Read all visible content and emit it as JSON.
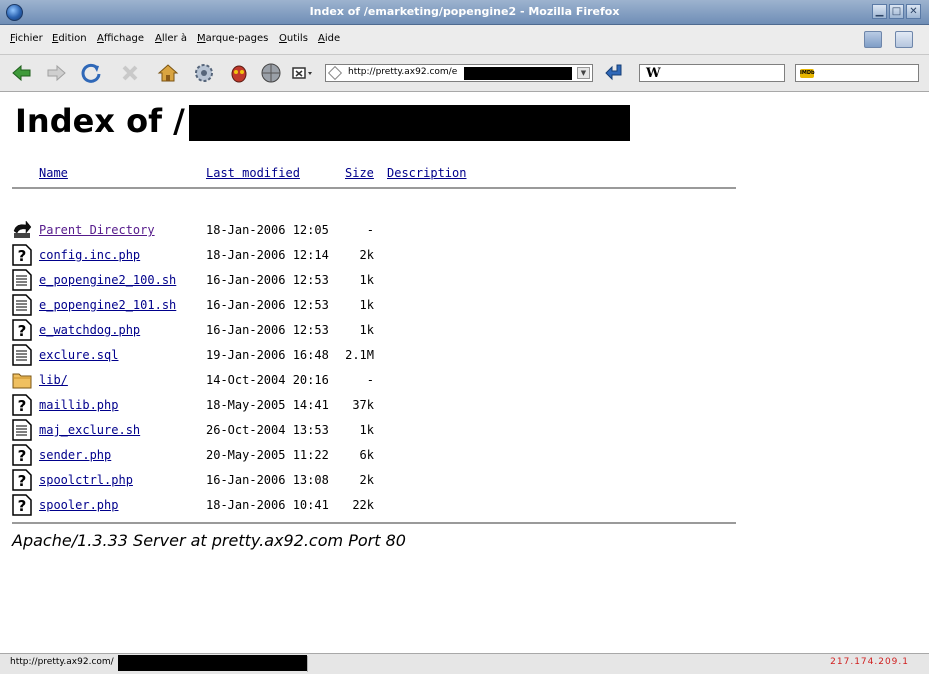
{
  "window": {
    "title": "Index of /emarketing/popengine2 - Mozilla Firefox",
    "min_label": "▁",
    "max_label": "□",
    "close_label": "✕"
  },
  "menu": [
    {
      "first": "F",
      "rest": "ichier"
    },
    {
      "first": "E",
      "rest": "dition"
    },
    {
      "first": "A",
      "rest": "ffichage"
    },
    {
      "first": "A",
      "rest": "ller à"
    },
    {
      "first": "M",
      "rest": "arque-pages"
    },
    {
      "first": "O",
      "rest": "utils"
    },
    {
      "first": "A",
      "rest": "ide"
    }
  ],
  "toolbar": {
    "url": "http://pretty.ax92.com/e",
    "search_engine_icon": "wikipedia-icon",
    "second_search_icon": "imdb-icon",
    "wiki_glyph": "W",
    "imdb_glyph": "IMDb"
  },
  "page": {
    "title": "Index of /",
    "columns": {
      "name": "Name",
      "modified": "Last modified",
      "size": "Size",
      "description": "Description"
    },
    "rows": [
      {
        "name": "Parent Directory",
        "date": "18-Jan-2006 12:05",
        "size": "-",
        "icon": "back-icon",
        "visited": true
      },
      {
        "name": "config.inc.php",
        "date": "18-Jan-2006 12:14",
        "size": "2k",
        "icon": "unknown-file-icon"
      },
      {
        "name": "e_popengine2_100.sh",
        "date": "16-Jan-2006 12:53",
        "size": "1k",
        "icon": "text-file-icon"
      },
      {
        "name": "e_popengine2_101.sh",
        "date": "16-Jan-2006 12:53",
        "size": "1k",
        "icon": "text-file-icon"
      },
      {
        "name": "e_watchdog.php",
        "date": "16-Jan-2006 12:53",
        "size": "1k",
        "icon": "unknown-file-icon"
      },
      {
        "name": "exclure.sql",
        "date": "19-Jan-2006 16:48",
        "size": "2.1M",
        "icon": "text-file-icon"
      },
      {
        "name": "lib/",
        "date": "14-Oct-2004 20:16",
        "size": "-",
        "icon": "folder-icon"
      },
      {
        "name": "maillib.php",
        "date": "18-May-2005 14:41",
        "size": "37k",
        "icon": "unknown-file-icon"
      },
      {
        "name": "maj_exclure.sh",
        "date": "26-Oct-2004 13:53",
        "size": "1k",
        "icon": "text-file-icon"
      },
      {
        "name": "sender.php",
        "date": "20-May-2005 11:22",
        "size": "6k",
        "icon": "unknown-file-icon"
      },
      {
        "name": "spoolctrl.php",
        "date": "16-Jan-2006 13:08",
        "size": "2k",
        "icon": "unknown-file-icon"
      },
      {
        "name": "spooler.php",
        "date": "18-Jan-2006 10:41",
        "size": "22k",
        "icon": "unknown-file-icon"
      }
    ],
    "address": "Apache/1.3.33 Server at pretty.ax92.com Port 80"
  },
  "status": {
    "text": "http://pretty.ax92.com/",
    "ip": "217.174.209.1"
  },
  "colors": {
    "link": "#00008b",
    "visited_link": "#551a8b",
    "titlebar": "#7f9cc3",
    "ip_text": "#d02020"
  }
}
